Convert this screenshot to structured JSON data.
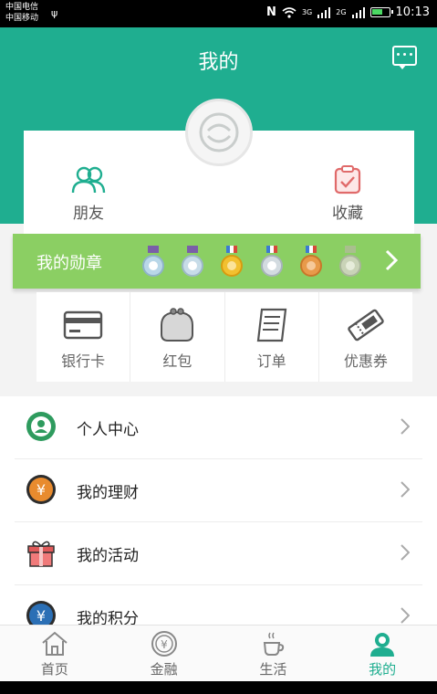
{
  "status_bar": {
    "carrier_1": "中国电信",
    "carrier_2": "中国移动",
    "network_1": "3G",
    "network_2": "2G",
    "time": "10:13"
  },
  "header": {
    "title": "我的"
  },
  "profile_card": {
    "friends_label": "朋友",
    "favorites_label": "收藏"
  },
  "medals": {
    "label": "我的勋章",
    "items": [
      {
        "name": "medal-silver-1",
        "color": "#b9d7e8"
      },
      {
        "name": "medal-silver-2",
        "color": "#c7dce8"
      },
      {
        "name": "medal-gold",
        "color": "#f2c030"
      },
      {
        "name": "medal-silver-3",
        "color": "#d3dbe0"
      },
      {
        "name": "medal-bronze",
        "color": "#e89a4a"
      },
      {
        "name": "medal-grey",
        "color": "#c9d3b7"
      }
    ]
  },
  "wallet": {
    "items": [
      {
        "label": "银行卡",
        "icon": "bank-card-icon"
      },
      {
        "label": "红包",
        "icon": "purse-icon"
      },
      {
        "label": "订单",
        "icon": "receipt-icon"
      },
      {
        "label": "优惠券",
        "icon": "coupon-icon"
      }
    ]
  },
  "menu": {
    "items": [
      {
        "label": "个人中心",
        "icon": "person-center-icon",
        "color": "#2e9b5e"
      },
      {
        "label": "我的理财",
        "icon": "yen-coin-icon",
        "color": "#e88b2e"
      },
      {
        "label": "我的活动",
        "icon": "gift-icon",
        "color": "#e05a5a"
      },
      {
        "label": "我的积分",
        "icon": "points-icon",
        "color": "#2b6fb5"
      }
    ]
  },
  "tabbar": {
    "items": [
      {
        "label": "首页",
        "icon": "home-icon",
        "active": false
      },
      {
        "label": "金融",
        "icon": "yen-icon",
        "active": false
      },
      {
        "label": "生活",
        "icon": "coffee-cup-icon",
        "active": false
      },
      {
        "label": "我的",
        "icon": "user-icon",
        "active": true
      }
    ]
  },
  "colors": {
    "brand": "#1fae90",
    "medal_bar": "#8bcf63"
  }
}
